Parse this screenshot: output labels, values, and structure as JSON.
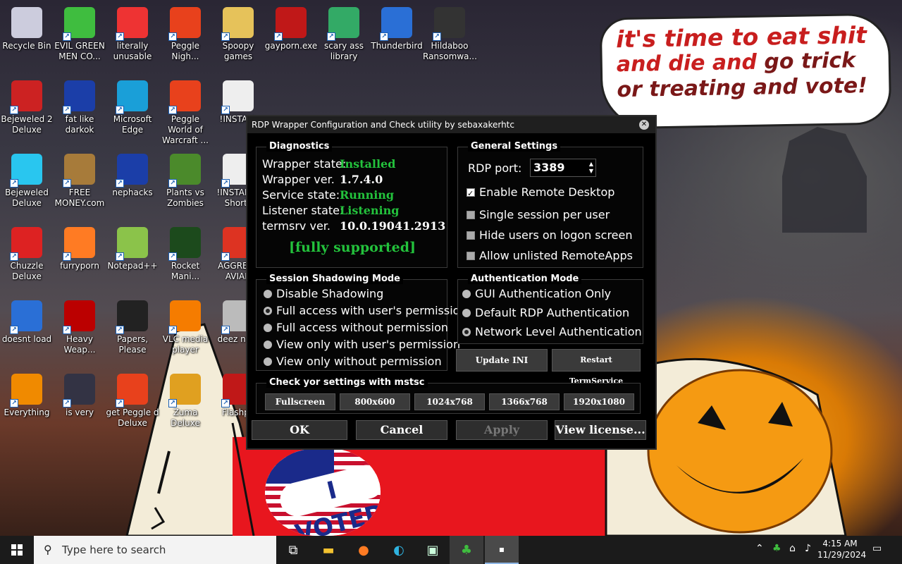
{
  "desktop": {
    "bubble": {
      "line1": "it's time to eat shit",
      "line2a": "and die and",
      "line2b": "go trick",
      "line3": "or treating and vote!"
    },
    "sticker_text": "I VOTED",
    "icons": [
      {
        "label": "Recycle Bin",
        "icon": "recycle-bin-icon"
      },
      {
        "label": "EVIL GREEN MEN CO...",
        "icon": "green-men-icon"
      },
      {
        "label": "literally unusable",
        "icon": "chrome-icon"
      },
      {
        "label": "Peggle Nigh...",
        "icon": "peggle-icon"
      },
      {
        "label": "Spoopy games",
        "icon": "folder-icon"
      },
      {
        "label": "gayporn.exe",
        "icon": "flash-icon"
      },
      {
        "label": "scary ass library",
        "icon": "library-icon"
      },
      {
        "label": "Thunderbird",
        "icon": "thunderbird-icon"
      },
      {
        "label": "Hildaboo Ransomwa...",
        "icon": "shield-icon"
      },
      {
        "label": "Bejeweled 2 Deluxe",
        "icon": "bejeweled2-icon"
      },
      {
        "label": "fat like darkok",
        "icon": "mpi-icon"
      },
      {
        "label": "Microsoft Edge",
        "icon": "edge-icon"
      },
      {
        "label": "Peggle World of Warcraft ...",
        "icon": "peggle-icon"
      },
      {
        "label": "!INSTALL",
        "icon": "text-file-icon"
      },
      {
        "label": "Bejeweled Deluxe",
        "icon": "diamond-icon"
      },
      {
        "label": "FREE MONEY.com",
        "icon": "money-bag-icon"
      },
      {
        "label": "nephacks",
        "icon": "mpi-icon"
      },
      {
        "label": "Plants vs Zombies",
        "icon": "plant-icon"
      },
      {
        "label": "!INSTALL - Shortc",
        "icon": "text-file-icon"
      },
      {
        "label": "Chuzzle Deluxe",
        "icon": "chuzzle-icon"
      },
      {
        "label": "furryporn",
        "icon": "firefox-icon"
      },
      {
        "label": "Notepad++",
        "icon": "notepad-icon"
      },
      {
        "label": "Rocket Mani...",
        "icon": "rocket-icon"
      },
      {
        "label": "AGGRESS AVIAN",
        "icon": "angry-bird-icon"
      },
      {
        "label": "doesnt load",
        "icon": "thunderbird-icon"
      },
      {
        "label": "Heavy Weap...",
        "icon": "radiation-icon"
      },
      {
        "label": "Papers, Please",
        "icon": "papers-icon"
      },
      {
        "label": "VLC media player",
        "icon": "vlc-icon"
      },
      {
        "label": "deez nuts",
        "icon": "copy-icon"
      },
      {
        "label": "Everything",
        "icon": "magnifier-icon"
      },
      {
        "label": "is very",
        "icon": "mpi-shield-icon"
      },
      {
        "label": "get Peggle d Deluxe",
        "icon": "peggle-icon"
      },
      {
        "label": "Zuma Deluxe",
        "icon": "zuma-icon"
      },
      {
        "label": "Flashpo",
        "icon": "flash-icon"
      }
    ]
  },
  "dialog": {
    "title": "RDP Wrapper Configuration and Check utility by sebaxakerhtc",
    "diagnostics": {
      "title": "Diagnostics",
      "rows": [
        {
          "label": "Wrapper state:",
          "value": "Installed",
          "status": "green"
        },
        {
          "label": "Wrapper ver.",
          "value": "1.7.4.0",
          "status": "white"
        },
        {
          "label": "Service state:",
          "value": "Running",
          "status": "green"
        },
        {
          "label": "Listener state:",
          "value": "Listening",
          "status": "green"
        },
        {
          "label": "termsrv ver.",
          "value": "10.0.19041.2913",
          "status": "white"
        }
      ],
      "support": "[fully supported]"
    },
    "general": {
      "title": "General Settings",
      "port_label": "RDP port:",
      "port_value": "3389",
      "checks": [
        {
          "label": "Enable Remote Desktop",
          "checked": true
        },
        {
          "label": "Single session per user",
          "checked": false
        },
        {
          "label": "Hide users on logon screen",
          "checked": false
        },
        {
          "label": "Allow unlisted RemoteApps",
          "checked": false
        }
      ]
    },
    "shadow": {
      "title": "Session Shadowing Mode",
      "options": [
        {
          "label": "Disable Shadowing",
          "selected": false
        },
        {
          "label": "Full access with user's permission",
          "selected": true
        },
        {
          "label": "Full access without permission",
          "selected": false
        },
        {
          "label": "View only with user's permission",
          "selected": false
        },
        {
          "label": "View only without permission",
          "selected": false
        }
      ]
    },
    "auth": {
      "title": "Authentication Mode",
      "options": [
        {
          "label": "GUI Authentication Only",
          "selected": false
        },
        {
          "label": "Default RDP Authentication",
          "selected": false
        },
        {
          "label": "Network Level Authentication",
          "selected": true
        }
      ]
    },
    "update_ini": "Update INI",
    "restart": "Restart TermService",
    "mstsc": {
      "title": "Check yor settings with mstsc",
      "buttons": [
        "Fullscreen",
        "800x600",
        "1024x768",
        "1366x768",
        "1920x1080"
      ]
    },
    "ok": "OK",
    "cancel": "Cancel",
    "apply": "Apply",
    "license": "View license..."
  },
  "taskbar": {
    "search_placeholder": "Type here to search",
    "time": "4:15 AM",
    "date": "11/29/2024"
  }
}
